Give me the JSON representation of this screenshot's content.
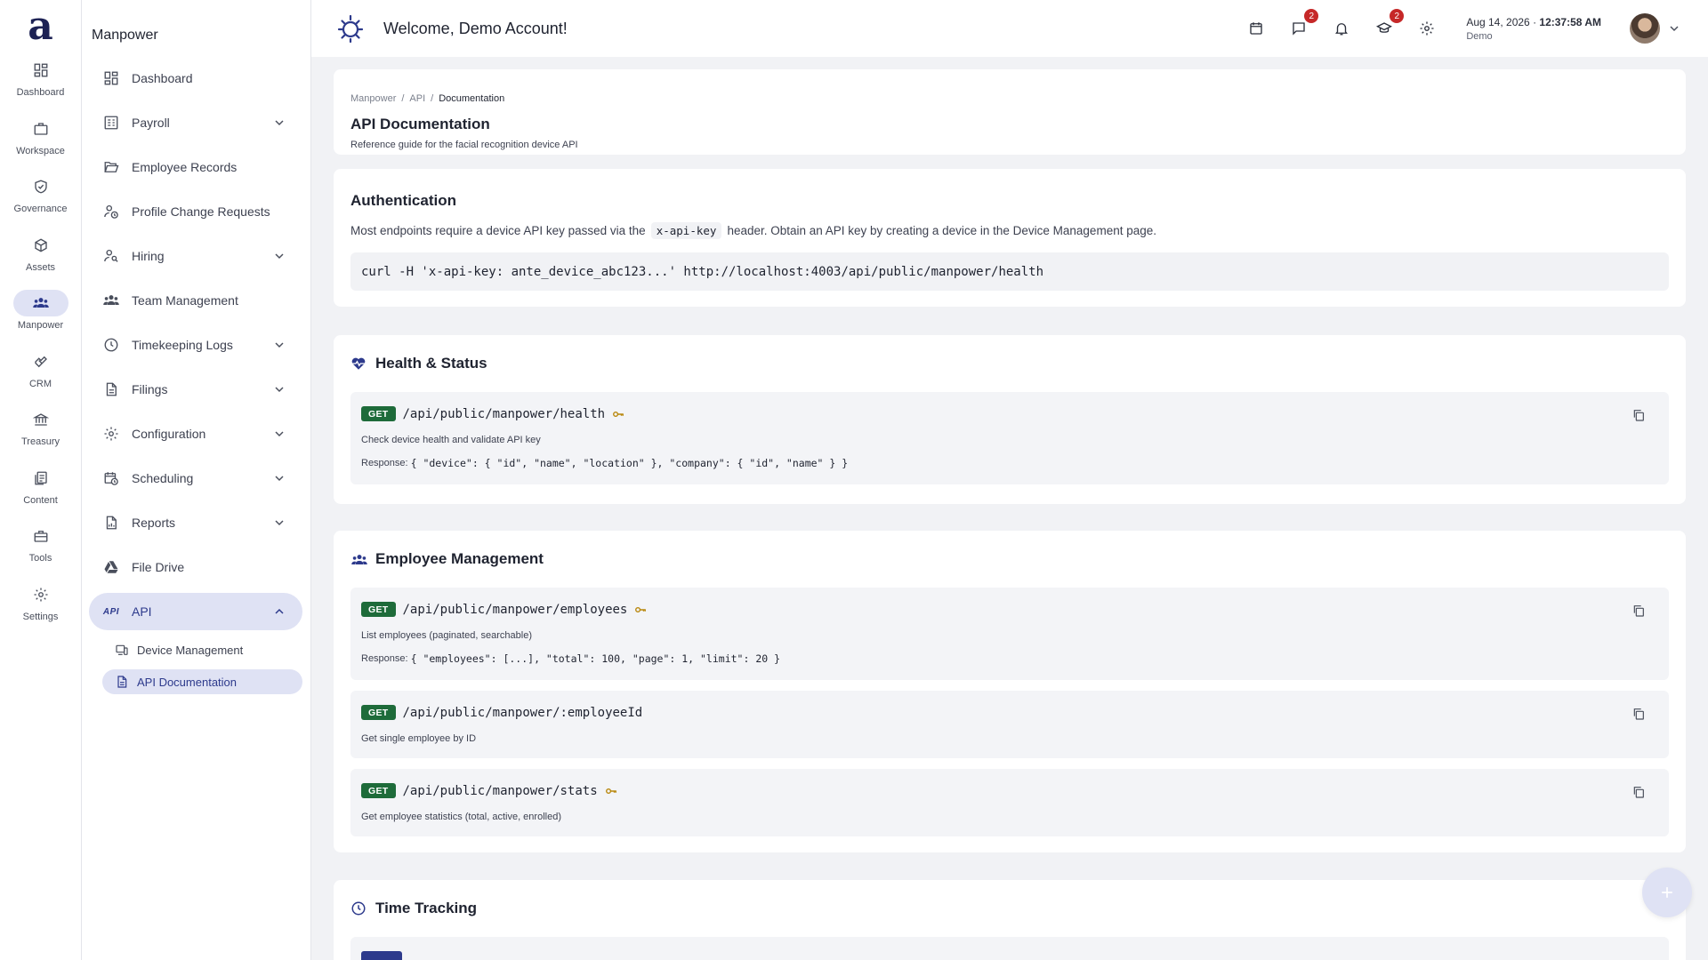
{
  "app": {
    "logo_letter": "a",
    "welcome": "Welcome, Demo Account!"
  },
  "rail": [
    {
      "label": "Dashboard",
      "icon": "dashboard-icon"
    },
    {
      "label": "Workspace",
      "icon": "briefcase-icon"
    },
    {
      "label": "Governance",
      "icon": "shield-check-icon"
    },
    {
      "label": "Assets",
      "icon": "cube-icon"
    },
    {
      "label": "Manpower",
      "icon": "people-icon",
      "active": true
    },
    {
      "label": "CRM",
      "icon": "handshake-icon"
    },
    {
      "label": "Treasury",
      "icon": "bank-icon"
    },
    {
      "label": "Content",
      "icon": "documents-icon"
    },
    {
      "label": "Tools",
      "icon": "toolbox-icon"
    },
    {
      "label": "Settings",
      "icon": "gear-icon"
    }
  ],
  "sidebar": {
    "title": "Manpower",
    "items": [
      {
        "label": "Dashboard",
        "icon": "dashboard-icon",
        "chevron": false
      },
      {
        "label": "Payroll",
        "icon": "payroll-icon",
        "chevron": true
      },
      {
        "label": "Employee Records",
        "icon": "folder-open-icon",
        "chevron": false
      },
      {
        "label": "Profile Change Requests",
        "icon": "person-clock-icon",
        "chevron": false
      },
      {
        "label": "Hiring",
        "icon": "person-search-icon",
        "chevron": true
      },
      {
        "label": "Team Management",
        "icon": "team-icon",
        "chevron": false
      },
      {
        "label": "Timekeeping Logs",
        "icon": "clock-icon",
        "chevron": true
      },
      {
        "label": "Filings",
        "icon": "file-icon",
        "chevron": true
      },
      {
        "label": "Configuration",
        "icon": "gear-icon",
        "chevron": true
      },
      {
        "label": "Scheduling",
        "icon": "calendar-clock-icon",
        "chevron": true
      },
      {
        "label": "Reports",
        "icon": "report-icon",
        "chevron": true
      },
      {
        "label": "File Drive",
        "icon": "drive-icon",
        "chevron": false
      },
      {
        "label": "API",
        "icon": "api-icon",
        "chevron": true,
        "expanded": true,
        "active": true
      }
    ],
    "api_icon_text": "API",
    "sub_items": [
      {
        "label": "Device Management",
        "icon": "device-icon"
      },
      {
        "label": "API Documentation",
        "icon": "document-icon",
        "active": true
      }
    ]
  },
  "header": {
    "badges": {
      "messages": "2",
      "academy": "2"
    },
    "date": "Aug 14, 2026",
    "time": "12:37:58 AM",
    "user": "Demo"
  },
  "page": {
    "breadcrumb": [
      "Manpower",
      "/",
      "API",
      "/",
      "Documentation"
    ],
    "title": "API Documentation",
    "subtitle": "Reference guide for the facial recognition device API"
  },
  "auth": {
    "title": "Authentication",
    "desc_before": "Most endpoints require a device API key passed via the",
    "header_code": "x-api-key",
    "desc_after": "header. Obtain an API key by creating a device in the Device Management page.",
    "curl": "curl -H 'x-api-key: ante_device_abc123...' http://localhost:4003/api/public/manpower/health"
  },
  "sections": {
    "health": {
      "title": "Health & Status",
      "endpoints": [
        {
          "method": "GET",
          "path": "/api/public/manpower/health",
          "key": true,
          "desc": "Check device health and validate API key",
          "response_label": "Response:",
          "response": "{ \"device\": { \"id\", \"name\", \"location\" }, \"company\": { \"id\", \"name\" } }"
        }
      ]
    },
    "employee": {
      "title": "Employee Management",
      "endpoints": [
        {
          "method": "GET",
          "path": "/api/public/manpower/employees",
          "key": true,
          "desc": "List employees (paginated, searchable)",
          "response_label": "Response:",
          "response": "{ \"employees\": [...], \"total\": 100, \"page\": 1, \"limit\": 20 }"
        },
        {
          "method": "GET",
          "path": "/api/public/manpower/:employeeId",
          "key": false,
          "desc": "Get single employee by ID"
        },
        {
          "method": "GET",
          "path": "/api/public/manpower/stats",
          "key": true,
          "desc": "Get employee statistics (total, active, enrolled)"
        }
      ]
    },
    "time": {
      "title": "Time Tracking"
    }
  },
  "colors": {
    "accent": "#2d3a8c",
    "active_bg": "#dfe2f4",
    "get_badge": "#1e6b3a",
    "badge_red": "#c62828",
    "key": "#b8860b"
  }
}
